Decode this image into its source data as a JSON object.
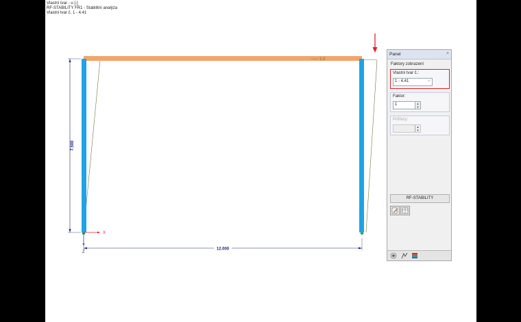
{
  "header": {
    "line1": "Vlastní tvar - u [-]",
    "line2": "RF-STABILITY FR1 - Stabilitní analýza",
    "line3": "Vlastní tvar č. 1 - 4.41"
  },
  "model": {
    "dim_vertical": "7.500",
    "dim_horizontal": "12.000",
    "eigen_label": "1.0",
    "axis_x": "X",
    "axis_z": "Z"
  },
  "panel": {
    "title": "Panel",
    "close": "×",
    "section_title": "Faktory zobrazení",
    "shape_label": "Vlastní tvar č.:",
    "shape_value": "1 - 4.41",
    "factor_label": "Faktor:",
    "factor_value": "1",
    "sections_label": "Průřezy:",
    "sections_value": "",
    "rf_button": "RF-STABILITY"
  },
  "icons": {
    "close": "close-icon",
    "dropdown": "chevron-down-icon",
    "edit": "edit-icon",
    "table": "table-icon",
    "display": "display-icon",
    "results": "results-icon",
    "color_scale": "color-scale-icon",
    "pointer": "red-arrow-icon"
  },
  "colors": {
    "beam": "#f2a56b",
    "column": "#1fa3e6",
    "highlight": "#e0202a",
    "dimension": "#1a237e"
  }
}
